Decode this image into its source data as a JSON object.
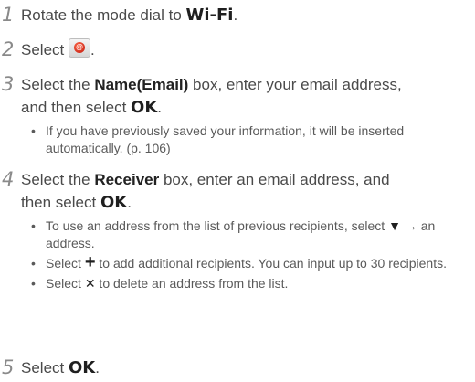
{
  "steps": [
    {
      "number": "1",
      "pre": "Rotate the mode dial to ",
      "key": "Wi-Fi",
      "post": "."
    },
    {
      "number": "2",
      "pre": "Select ",
      "icon": "email-icon",
      "post": "."
    },
    {
      "number": "3",
      "line1_pre": "Select the ",
      "line1_bold": "Name(Email)",
      "line1_post": " box, enter your email address,",
      "line2_pre": "and then select ",
      "line2_key": "OK",
      "line2_post": ".",
      "bullets": [
        "If you have previously saved your information, it will be inserted automatically. (p. 106)"
      ]
    },
    {
      "number": "4",
      "line1_pre": "Select the ",
      "line1_bold": "Receiver",
      "line1_post": " box, enter an email address, and",
      "line2_pre": "then select ",
      "line2_key": "OK",
      "line2_post": ".",
      "bullets": [
        {
          "pre": "To use an address from the list of previous recipients, select ",
          "glyph": "▼",
          "post": " → an address."
        },
        {
          "pre": "Select ",
          "glyph": "+",
          "post": " to add additional recipients. You can input up to 30 recipients."
        },
        {
          "pre": "Select ",
          "glyph": "✕",
          "post": " to delete an address from the list."
        }
      ]
    },
    {
      "number": "5",
      "pre": "Select ",
      "key": "OK",
      "post": "."
    }
  ]
}
